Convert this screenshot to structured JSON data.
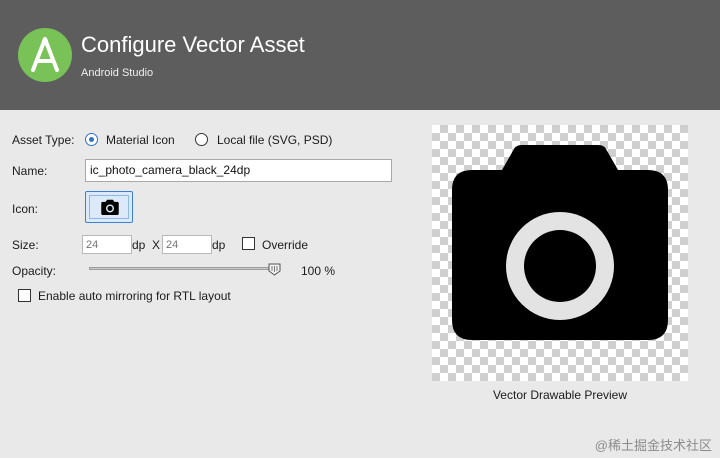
{
  "header": {
    "title": "Configure Vector Asset",
    "subtitle": "Android Studio",
    "logo_icon": "android-studio-logo-icon",
    "logo_color": "#78c257"
  },
  "asset_type": {
    "label": "Asset Type:",
    "options": [
      {
        "label": "Material Icon",
        "selected": true
      },
      {
        "label": "Local file (SVG, PSD)",
        "selected": false
      }
    ]
  },
  "name": {
    "label": "Name:",
    "value": "ic_photo_camera_black_24dp"
  },
  "icon": {
    "label": "Icon:",
    "button_icon": "photo-camera-icon"
  },
  "size": {
    "label": "Size:",
    "width_placeholder": "24",
    "height_placeholder": "24",
    "unit": "dp",
    "separator": "X",
    "override_label": "Override",
    "override_checked": false
  },
  "opacity": {
    "label": "Opacity:",
    "value_percent": 100,
    "value_text": "100 %"
  },
  "rtl": {
    "label": "Enable auto mirroring for RTL layout",
    "checked": false
  },
  "preview": {
    "caption": "Vector Drawable Preview",
    "icon": "photo-camera-icon"
  },
  "watermark": "@稀土掘金技术社区"
}
